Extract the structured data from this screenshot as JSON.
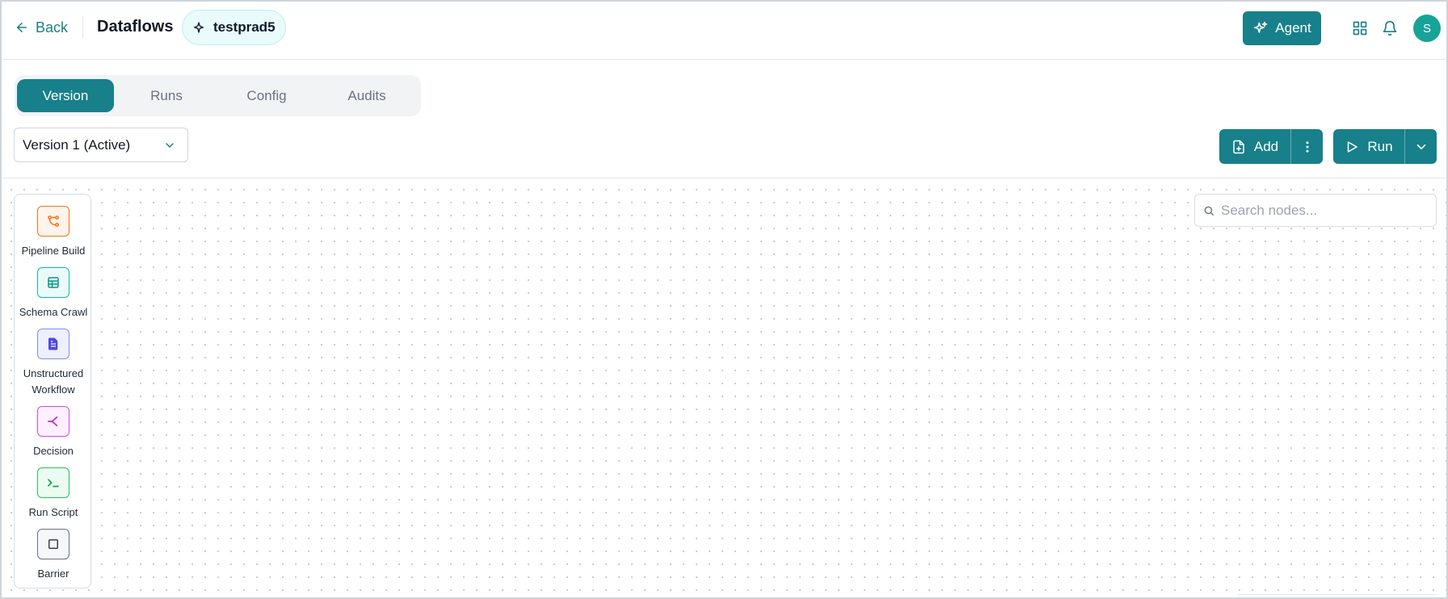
{
  "header": {
    "back_label": "Back",
    "app_title": "Dataflows",
    "flow_name": "testprad5",
    "agent_label": "Agent",
    "avatar_initial": "S"
  },
  "tabs": [
    {
      "label": "Version",
      "active": true
    },
    {
      "label": "Runs",
      "active": false
    },
    {
      "label": "Config",
      "active": false
    },
    {
      "label": "Audits",
      "active": false
    }
  ],
  "toolbar": {
    "version_selected": "Version 1 (Active)",
    "add_label": "Add",
    "run_label": "Run"
  },
  "palette": {
    "nodes": [
      {
        "label": "Pipeline Build",
        "icon": "pipeline-icon",
        "color": "#f97316",
        "bg": "#fff4ec"
      },
      {
        "label": "Schema Crawl",
        "icon": "table-icon",
        "color": "#0d9488",
        "bg": "#ebfaf8"
      },
      {
        "label": "Unstructured\nWorkflow",
        "icon": "document-icon",
        "color": "#4f46e5",
        "bg": "#eef0ff"
      },
      {
        "label": "Decision",
        "icon": "branch-icon",
        "color": "#c026d3",
        "bg": "#fcf0fe"
      },
      {
        "label": "Run Script",
        "icon": "terminal-icon",
        "color": "#16a34a",
        "bg": "#ecfbf1"
      },
      {
        "label": "Barrier",
        "icon": "square-icon",
        "color": "#374151",
        "bg": "#f6f7f9"
      }
    ]
  },
  "search": {
    "placeholder": "Search nodes..."
  },
  "colors": {
    "accent": "#17808a",
    "avatar": "#17a398",
    "chip_bg": "#e9fbfb"
  }
}
